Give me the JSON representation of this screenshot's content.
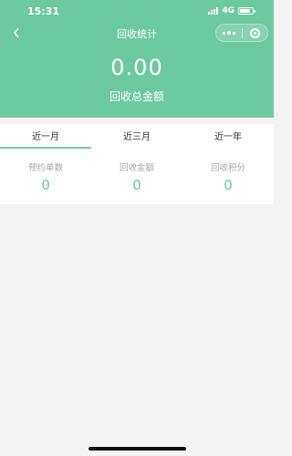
{
  "status_bar": {
    "time": "15:31",
    "network": "4G"
  },
  "nav": {
    "title": "回收统计"
  },
  "summary": {
    "total_value": "0.00",
    "total_label": "回收总金额"
  },
  "tabs": [
    {
      "label": "近一月",
      "active": true
    },
    {
      "label": "近三月",
      "active": false
    },
    {
      "label": "近一年",
      "active": false
    }
  ],
  "stats": [
    {
      "label": "预约单数",
      "value": "0"
    },
    {
      "label": "回收金额",
      "value": "0"
    },
    {
      "label": "回收积分",
      "value": "0"
    }
  ],
  "colors": {
    "accent": "#6cc9a0",
    "background": "#f4f4f4"
  },
  "icons": [
    "back-icon",
    "more-icon",
    "close-target-icon",
    "signal-icon",
    "battery-icon"
  ]
}
